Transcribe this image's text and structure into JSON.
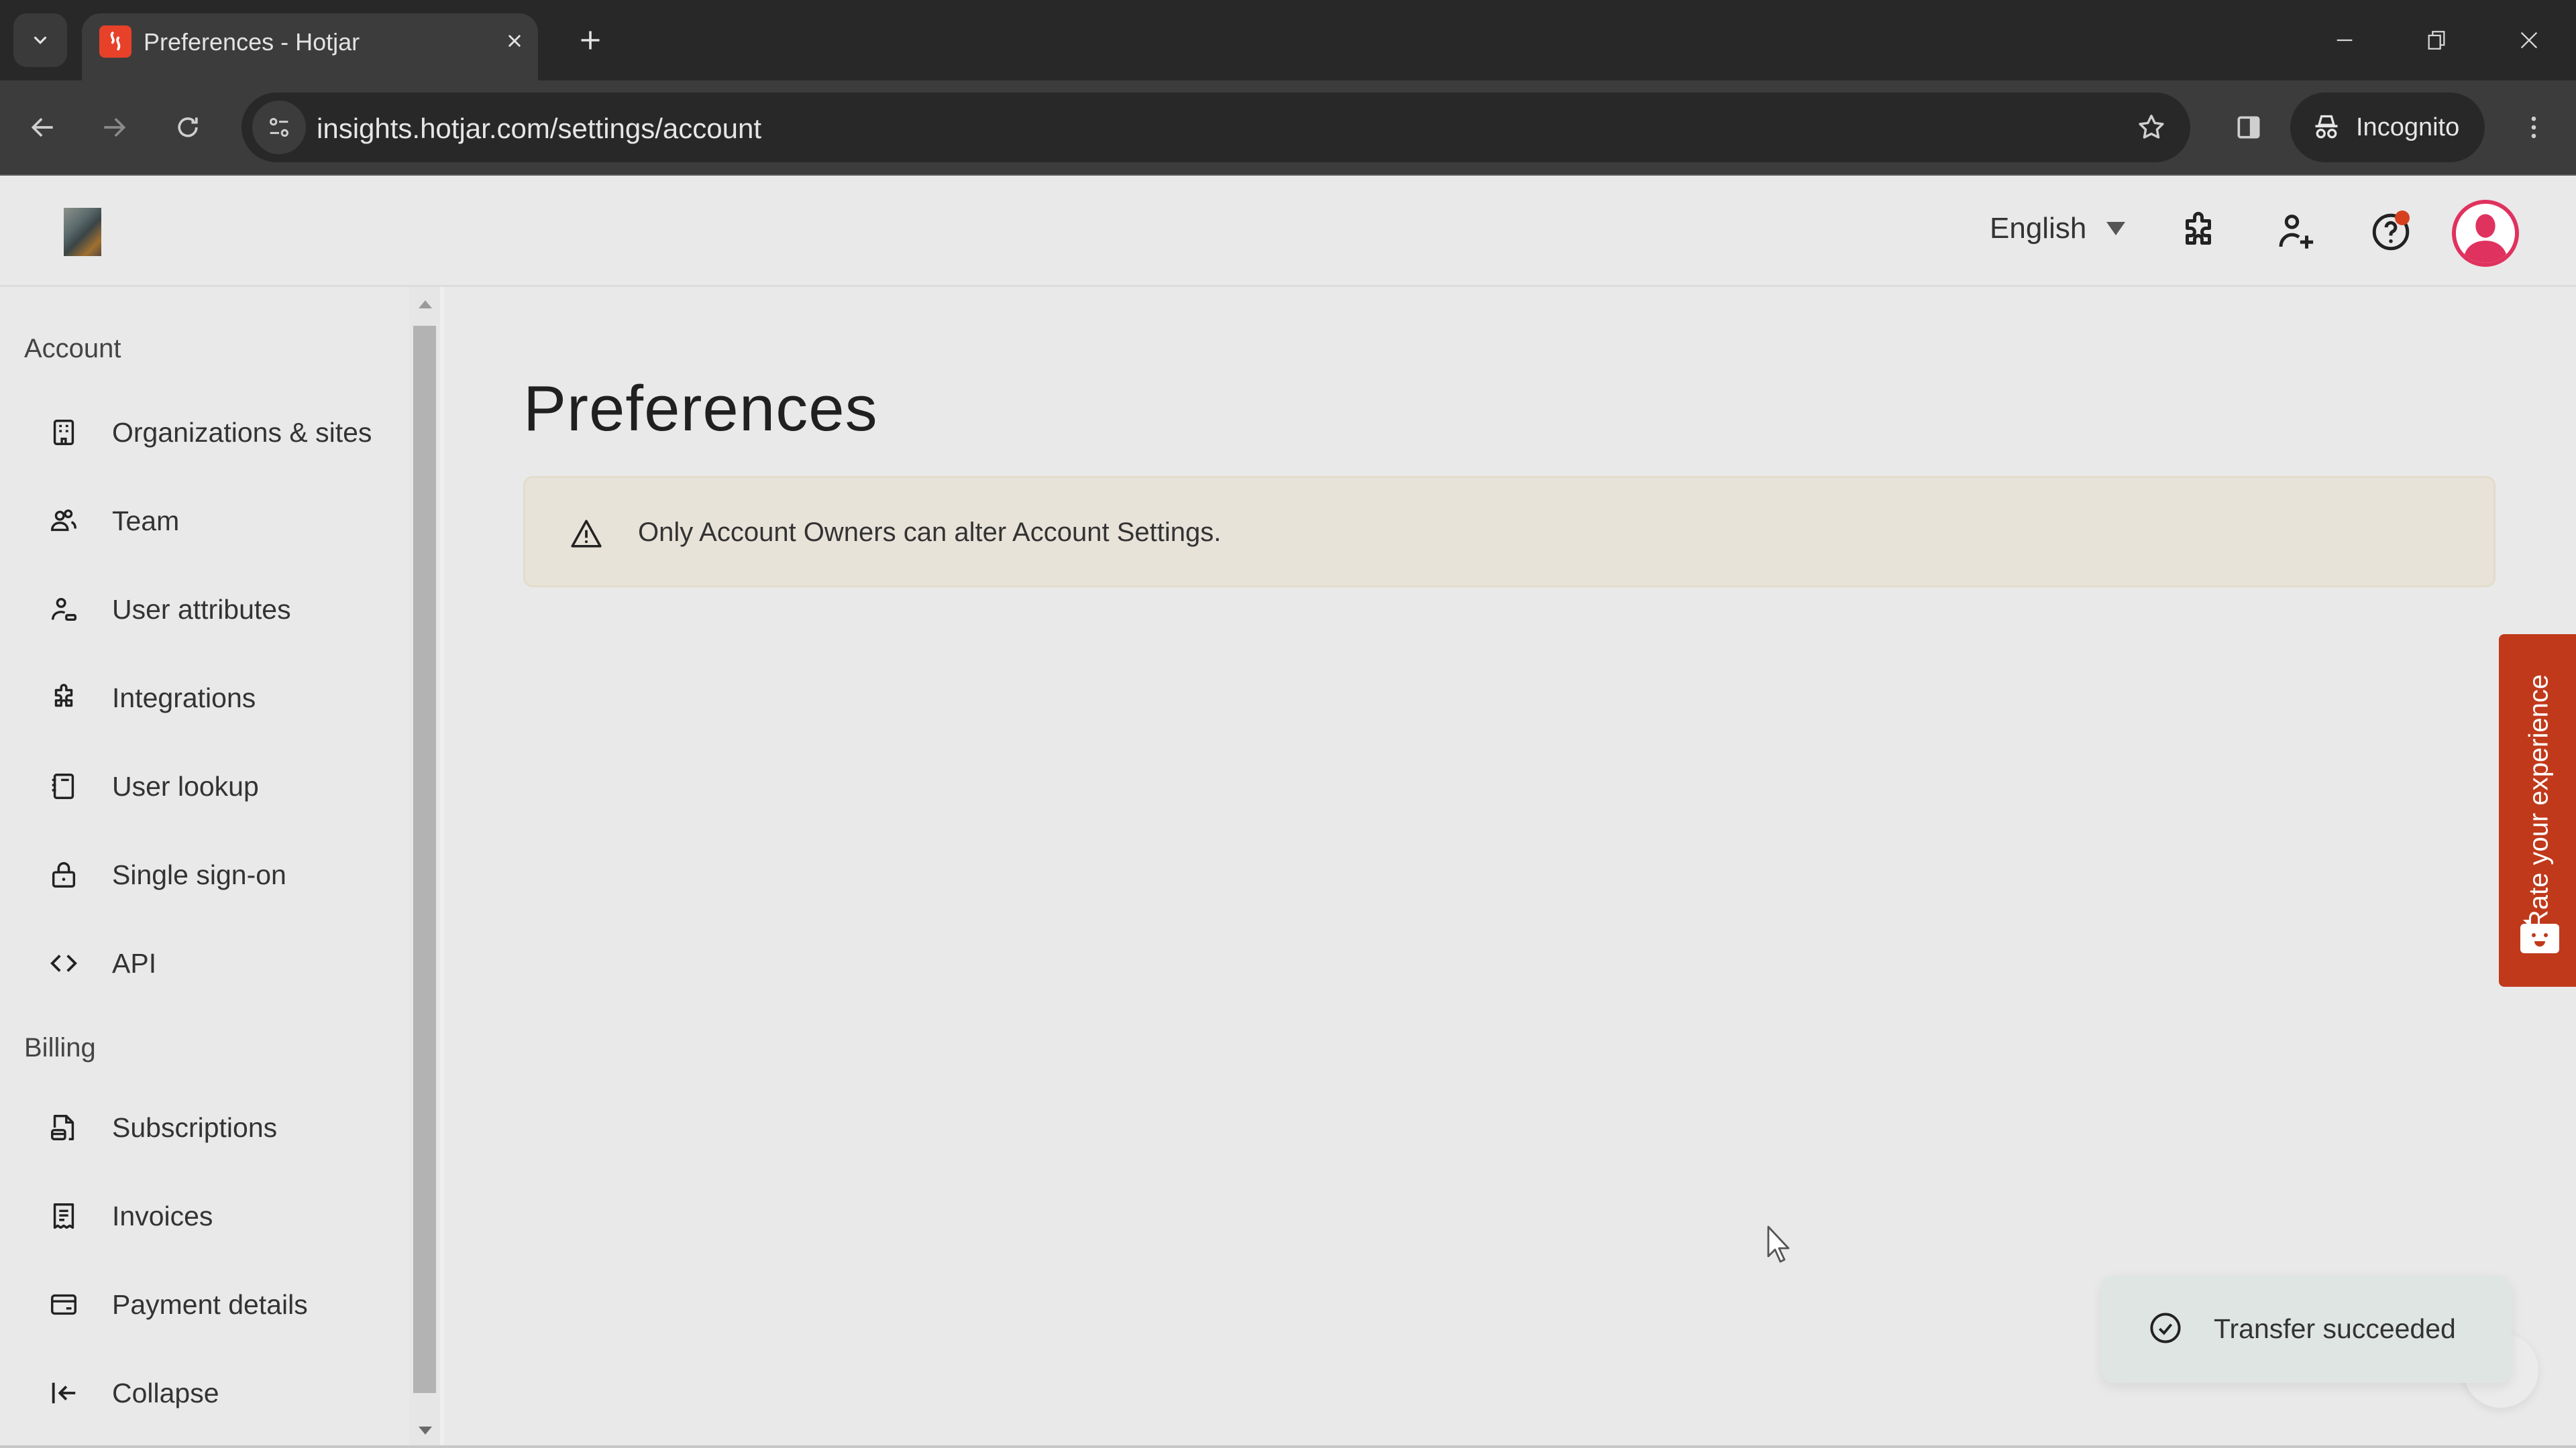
{
  "browser": {
    "tab_title": "Preferences - Hotjar",
    "url": "insights.hotjar.com/settings/account",
    "incognito_label": "Incognito",
    "window_controls": [
      "minimize",
      "restore",
      "close"
    ]
  },
  "header": {
    "language": "English",
    "icons": [
      "integrations-icon",
      "invite-user-icon",
      "help-icon",
      "user-avatar"
    ],
    "help_has_notification": true
  },
  "sidebar": {
    "sections": [
      {
        "label": "Account",
        "items": [
          {
            "label": "Organizations & sites",
            "icon": "building-icon"
          },
          {
            "label": "Team",
            "icon": "team-icon"
          },
          {
            "label": "User attributes",
            "icon": "user-attributes-icon"
          },
          {
            "label": "Integrations",
            "icon": "puzzle-icon"
          },
          {
            "label": "User lookup",
            "icon": "notebook-icon"
          },
          {
            "label": "Single sign-on",
            "icon": "lock-icon"
          },
          {
            "label": "API",
            "icon": "code-icon"
          }
        ]
      },
      {
        "label": "Billing",
        "items": [
          {
            "label": "Subscriptions",
            "icon": "subscription-icon"
          },
          {
            "label": "Invoices",
            "icon": "receipt-icon"
          },
          {
            "label": "Payment details",
            "icon": "credit-card-icon"
          }
        ]
      }
    ],
    "collapse_label": "Collapse"
  },
  "main": {
    "title": "Preferences",
    "alert": "Only Account Owners can alter Account Settings."
  },
  "feedback_widget": {
    "label": "Rate your experience"
  },
  "toast": {
    "message": "Transfer succeeded"
  },
  "colors": {
    "brand_red": "#c0391b",
    "avatar_pink": "#e0325e",
    "notification_dot": "#d7401f",
    "alert_bg": "#e8e3d9",
    "toast_bg": "#dfe5e3"
  }
}
